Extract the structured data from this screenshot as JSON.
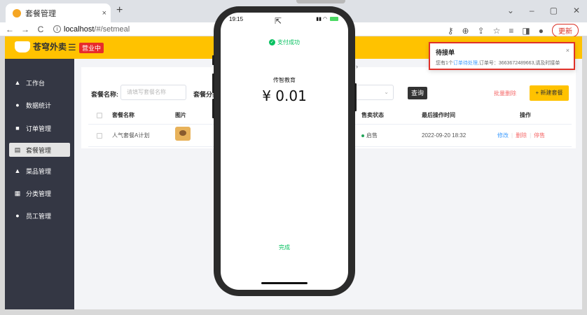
{
  "browser": {
    "tab_title": "套餐管理",
    "tab_close": "×",
    "new_tab": "+",
    "url_host": "localhost",
    "url_path": "/#/setmeal",
    "update_label": "更新"
  },
  "header": {
    "logo_text": "苍穹外卖",
    "logo_sub": "THE SKY TAKE OUT",
    "status": "营业中"
  },
  "sidebar": {
    "items": [
      {
        "label": "工作台",
        "icon": "home-icon"
      },
      {
        "label": "数据统计",
        "icon": "chart-icon"
      },
      {
        "label": "订单管理",
        "icon": "order-icon"
      },
      {
        "label": "套餐管理",
        "icon": "setmeal-icon"
      },
      {
        "label": "菜品管理",
        "icon": "dish-icon"
      },
      {
        "label": "分类管理",
        "icon": "category-icon"
      },
      {
        "label": "员工管理",
        "icon": "employee-icon"
      }
    ]
  },
  "filters": {
    "name_label": "套餐名称:",
    "name_placeholder": "请填写套餐名称",
    "category_label": "套餐分类",
    "search_btn": "查询",
    "batch_delete": "批量删除",
    "new_btn": "+ 新建套餐"
  },
  "table": {
    "headers": [
      "套餐名称",
      "图片",
      "售卖状态",
      "最后操作时间",
      "操作"
    ],
    "rows": [
      {
        "name": "人气套餐A计划",
        "status": "启售",
        "time": "2022-09-20 18:32",
        "edit": "修改",
        "delete": "删除",
        "toggle": "停售"
      }
    ]
  },
  "notification": {
    "title": "待接单",
    "prefix": "您有1个",
    "link": "订单待处理",
    "suffix": ",订单号：3663672489663,请及时接单"
  },
  "phone": {
    "time": "19:15",
    "success": "支付成功",
    "merchant": "传智教育",
    "amount": "¥ 0.01",
    "done": "完成"
  },
  "colors": {
    "accent": "#ffc200",
    "sidebar": "#343744",
    "success": "#07c160",
    "danger": "#f56c6c",
    "link": "#419eff"
  }
}
